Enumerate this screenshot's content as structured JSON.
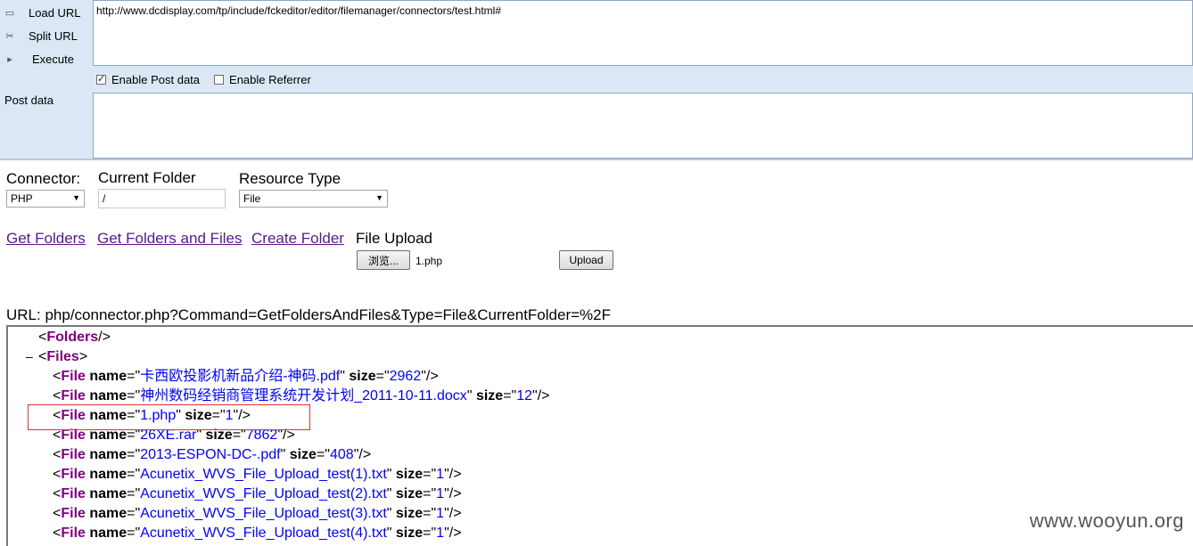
{
  "hackbar": {
    "load_url": "Load URL",
    "split_url": "Split URL",
    "execute": "Execute",
    "url": "http://www.dcdisplay.com/tp/include/fckeditor/editor/filemanager/connectors/test.html#",
    "enable_post": "Enable Post data",
    "enable_referrer": "Enable Referrer",
    "post_label": "Post data"
  },
  "form": {
    "connector_label": "Connector:",
    "connector_value": "PHP",
    "folder_label": "Current Folder",
    "folder_value": "/",
    "resource_label": "Resource Type",
    "resource_value": "File",
    "get_folders": "Get Folders",
    "get_folders_files": "Get Folders and Files",
    "create_folder": "Create Folder",
    "file_upload": "File Upload",
    "browse": "浏览...",
    "file_chosen": "1.php",
    "upload": "Upload",
    "url_line": "URL: php/connector.php?Command=GetFoldersAndFiles&Type=File&CurrentFolder=%2F"
  },
  "xml": {
    "folders_tag": "Folders",
    "files_tag": "Files",
    "file_tag": "File",
    "name_attr": "name",
    "size_attr": "size",
    "files": [
      {
        "name": "卡西欧投影机新品介绍-神码.pdf",
        "size": "2962"
      },
      {
        "name": "神州数码经销商管理系统开发计划_2011-10-11.docx",
        "size": "12"
      },
      {
        "name": "1.php",
        "size": "1"
      },
      {
        "name": "26XE.rar",
        "size": "7862"
      },
      {
        "name": "2013-ESPON-DC-.pdf",
        "size": "408"
      },
      {
        "name": "Acunetix_WVS_File_Upload_test(1).txt",
        "size": "1"
      },
      {
        "name": "Acunetix_WVS_File_Upload_test(2).txt",
        "size": "1"
      },
      {
        "name": "Acunetix_WVS_File_Upload_test(3).txt",
        "size": "1"
      },
      {
        "name": "Acunetix_WVS_File_Upload_test(4).txt",
        "size": "1"
      }
    ]
  },
  "watermark": "www.wooyun.org"
}
